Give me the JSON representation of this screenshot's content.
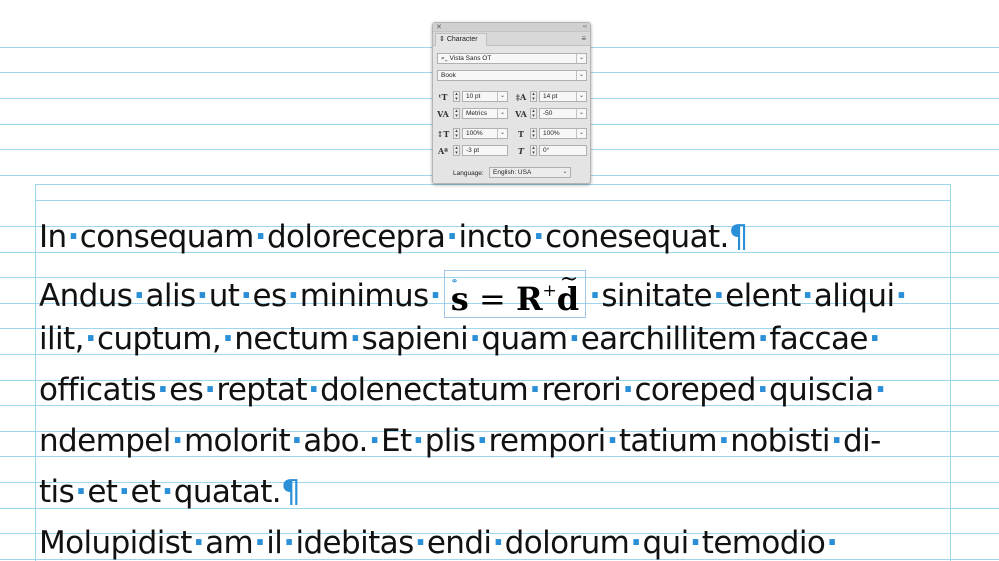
{
  "panel": {
    "title": "Character",
    "font_family": "Vista Sans OT",
    "font_style": "Book",
    "font_size": "10 pt",
    "leading": "14 pt",
    "kerning": "Metrics",
    "tracking": "-50",
    "vertical_scale": "100%",
    "horizontal_scale": "100%",
    "baseline_shift": "-3 pt",
    "skew": "0°",
    "language_label": "Language:",
    "language": "English: USA"
  },
  "document": {
    "lines": [
      [
        "In",
        "consequam",
        "dolorecepra",
        "incto",
        "conesequat."
      ],
      [
        "Andus",
        "alis",
        "ut",
        "es",
        "minimus"
      ],
      [
        "ilit,",
        "cuptum,",
        "nectum",
        "sapieni",
        "quam",
        "earchillitem",
        "faccae"
      ],
      [
        "officatis",
        "es",
        "reptat",
        "dolenectatum",
        "rerori",
        "coreped",
        "quiscia"
      ],
      [
        "ndempel",
        "molorit",
        "abo.",
        "Et",
        "plis",
        "rempori",
        "tatium",
        "nobisti",
        "di-"
      ],
      [
        "tis",
        "et",
        "et",
        "quatat."
      ],
      [
        "Molupidist",
        "am",
        "il",
        "idebitas",
        "endi",
        "dolorum",
        "qui",
        "temodio"
      ]
    ],
    "line2_after_equation": [
      "sinitate",
      "elent",
      "aliqui"
    ],
    "equation": {
      "s": "s",
      "eq": "=",
      "R": "R",
      "sup": "+",
      "d": "d"
    },
    "pilcrow": "¶"
  },
  "icons": {
    "close": "close-icon",
    "collapse": "collapse-icon",
    "menu": "panel-menu-icon",
    "search": "search-icon"
  },
  "colors": {
    "guide": "#9fd6ec",
    "invisibles": "#2a8fd6"
  }
}
